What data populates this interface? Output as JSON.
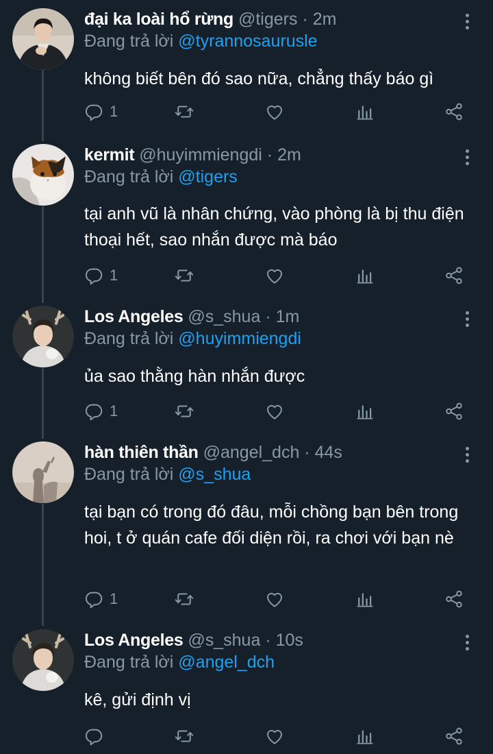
{
  "tweets": [
    {
      "name": "đại ka loài hổ rừng",
      "handle": "@tigers",
      "sep": "·",
      "time": "2m",
      "reply_prefix": "Đang trả lời",
      "reply_to": "@tyrannosaurusle",
      "text": "không biết bên đó sao nữa, chẳng thấy báo gì",
      "reply_count": "1",
      "avatar": "avatar-man-dark-jacket"
    },
    {
      "name": "kermit",
      "handle": "@huyimmiengdi",
      "sep": "·",
      "time": "2m",
      "reply_prefix": "Đang trả lời",
      "reply_to": "@tigers",
      "text": "tại anh vũ là nhân chứng, vào phòng là bị thu điện thoại hết, sao nhắn được mà báo",
      "reply_count": "1",
      "avatar": "avatar-calico-cat"
    },
    {
      "name": "Los Angeles",
      "handle": "@s_shua",
      "sep": "·",
      "time": "1m",
      "reply_prefix": "Đang trả lời",
      "reply_to": "@huyimmiengdi",
      "text": "ủa sao thằng hàn nhắn được",
      "reply_count": "1",
      "avatar": "avatar-person-deer-antlers"
    },
    {
      "name": "hàn thiên thần",
      "handle": "@angel_dch",
      "sep": "·",
      "time": "44s",
      "reply_prefix": "Đang trả lời",
      "reply_to": "@s_shua",
      "text": "tại bạn có trong đó đâu, mỗi chồng bạn bên trong hoi, t ở quán cafe đối diện rồi, ra chơi với bạn nè",
      "reply_count": "1",
      "avatar": "avatar-shadow-silhouette"
    },
    {
      "name": "Los Angeles",
      "handle": "@s_shua",
      "sep": "·",
      "time": "10s",
      "reply_prefix": "Đang trả lời",
      "reply_to": "@angel_dch",
      "text": "kê, gửi định vị",
      "reply_count": "",
      "avatar": "avatar-person-deer-antlers"
    }
  ],
  "icons": {
    "reply": "reply-icon",
    "retweet": "retweet-icon",
    "like": "heart-icon",
    "analytics": "analytics-icon",
    "share": "share-icon",
    "more": "more-vertical-icon"
  },
  "colors": {
    "background": "#15202b",
    "secondary_text": "#8899a6",
    "mention": "#1da1f2",
    "thread_line": "#38444d"
  }
}
